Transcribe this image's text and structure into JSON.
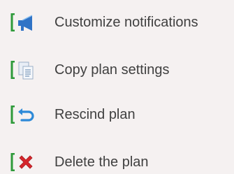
{
  "menu": {
    "items": [
      {
        "label": "Customize notifications",
        "icon": "megaphone-icon"
      },
      {
        "label": "Copy plan settings",
        "icon": "copy-document-icon"
      },
      {
        "label": "Rescind plan",
        "icon": "undo-arrow-icon"
      },
      {
        "label": "Delete the plan",
        "icon": "red-x-icon"
      }
    ]
  },
  "colors": {
    "bracket": "#2e9a3a",
    "megaphone": "#2f73c6",
    "undo": "#2d8ad8",
    "delete": "#d6262c",
    "label": "#404040",
    "background": "#f5f1f1"
  }
}
